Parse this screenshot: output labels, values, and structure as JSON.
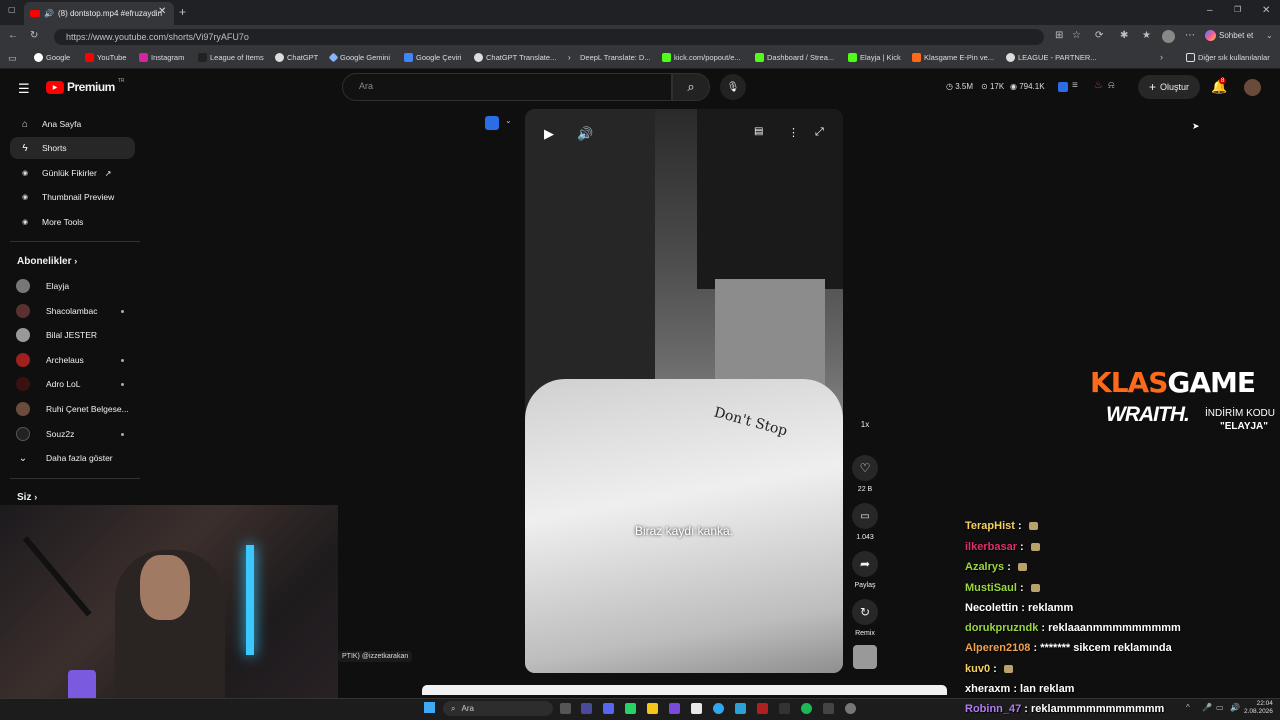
{
  "browser": {
    "tab_title": "(8) dontstop.mp4 #efruzaydin",
    "url": "https://www.youtube.com/shorts/Vi97ryAFU7o",
    "bookmarks": [
      "Google",
      "YouTube",
      "Instagram",
      "League of Items",
      "ChatGPT",
      "Google Gemini",
      "Google Çeviri",
      "ChatGPT Translate...",
      "DeepL Translate: D...",
      "kick.com/popout/e...",
      "Dashboard / Strea...",
      "Elayja | Kick",
      "Klasgame E-Pin ve...",
      "LEAGUE - PARTNER..."
    ],
    "other_bookmarks": "Diğer sık kullanılanlar",
    "chat_button": "Sohbet et"
  },
  "youtube": {
    "logo": "Premium",
    "logo_sup": "TR",
    "search_placeholder": "Ara",
    "stats": {
      "views": "3.5M",
      "subs": "17K",
      "watch": "794.1K"
    },
    "create_label": "Oluştur",
    "notif_count": "8"
  },
  "sidebar": {
    "main": [
      {
        "label": "Ana Sayfa",
        "icon": "home-icon"
      },
      {
        "label": "Shorts",
        "icon": "shorts-icon"
      }
    ],
    "tools": [
      "Günlük Fikirler",
      "Thumbnail Preview",
      "More Tools"
    ],
    "subs_header": "Abonelikler",
    "subs": [
      {
        "name": "Elayja",
        "dot": false
      },
      {
        "name": "Shacolambac",
        "dot": true
      },
      {
        "name": "Bilal JESTER",
        "dot": false
      },
      {
        "name": "Archelaus",
        "dot": true
      },
      {
        "name": "Adro LoL",
        "dot": true
      },
      {
        "name": "Ruhi Çenet Belgese...",
        "dot": true
      },
      {
        "name": "Souz2z",
        "dot": true
      }
    ],
    "show_more": "Daha fazla göster",
    "you_header": "Siz"
  },
  "video": {
    "caption": "Biraz kaydı kanka.",
    "tattoo": "Don't Stop",
    "speed": "1x",
    "likes": "22 B",
    "comments": "1.043",
    "share": "Paylaş",
    "remix": "Remix",
    "credit": "PTIK) @izzetkarakan"
  },
  "overlay": {
    "klas1": "KLAS",
    "klas2": "GAME",
    "wraith": "WRAITH.",
    "discount": "İNDİRİM KODU",
    "code": "\"ELAYJA\""
  },
  "chat": [
    {
      "user": "TerapHist",
      "color": "#f4d160",
      "msg": "",
      "emote": true
    },
    {
      "user": "ilkerbasar",
      "color": "#e0306a",
      "msg": "",
      "emote": true
    },
    {
      "user": "Azalrys",
      "color": "#9bd63e",
      "msg": "",
      "emote": true
    },
    {
      "user": "MustiSaul",
      "color": "#9bd63e",
      "msg": "",
      "emote": true
    },
    {
      "user": "Necolettin",
      "color": "#ffffff",
      "msg": "reklamm",
      "emote": false
    },
    {
      "user": "dorukpruzndk",
      "color": "#9bd63e",
      "msg": "reklaaanmmmmmmmmm",
      "emote": false
    },
    {
      "user": "Alperen2108",
      "color": "#f0a050",
      "msg": "******* sikcem reklamında",
      "emote": false
    },
    {
      "user": "kuv0",
      "color": "#f4d160",
      "msg": "",
      "emote": true
    },
    {
      "user": "xheraxm",
      "color": "#ffffff",
      "msg": "lan reklam",
      "emote": false
    },
    {
      "user": "Robinn_47",
      "color": "#b07cf0",
      "msg": "reklammmmmmmmmmm",
      "emote": false
    }
  ],
  "taskbar": {
    "search": "Ara",
    "time": "22:04",
    "date": "2.08.2026"
  },
  "colors": {
    "accent": "#ff0000",
    "klas": "#ff6a1a"
  }
}
